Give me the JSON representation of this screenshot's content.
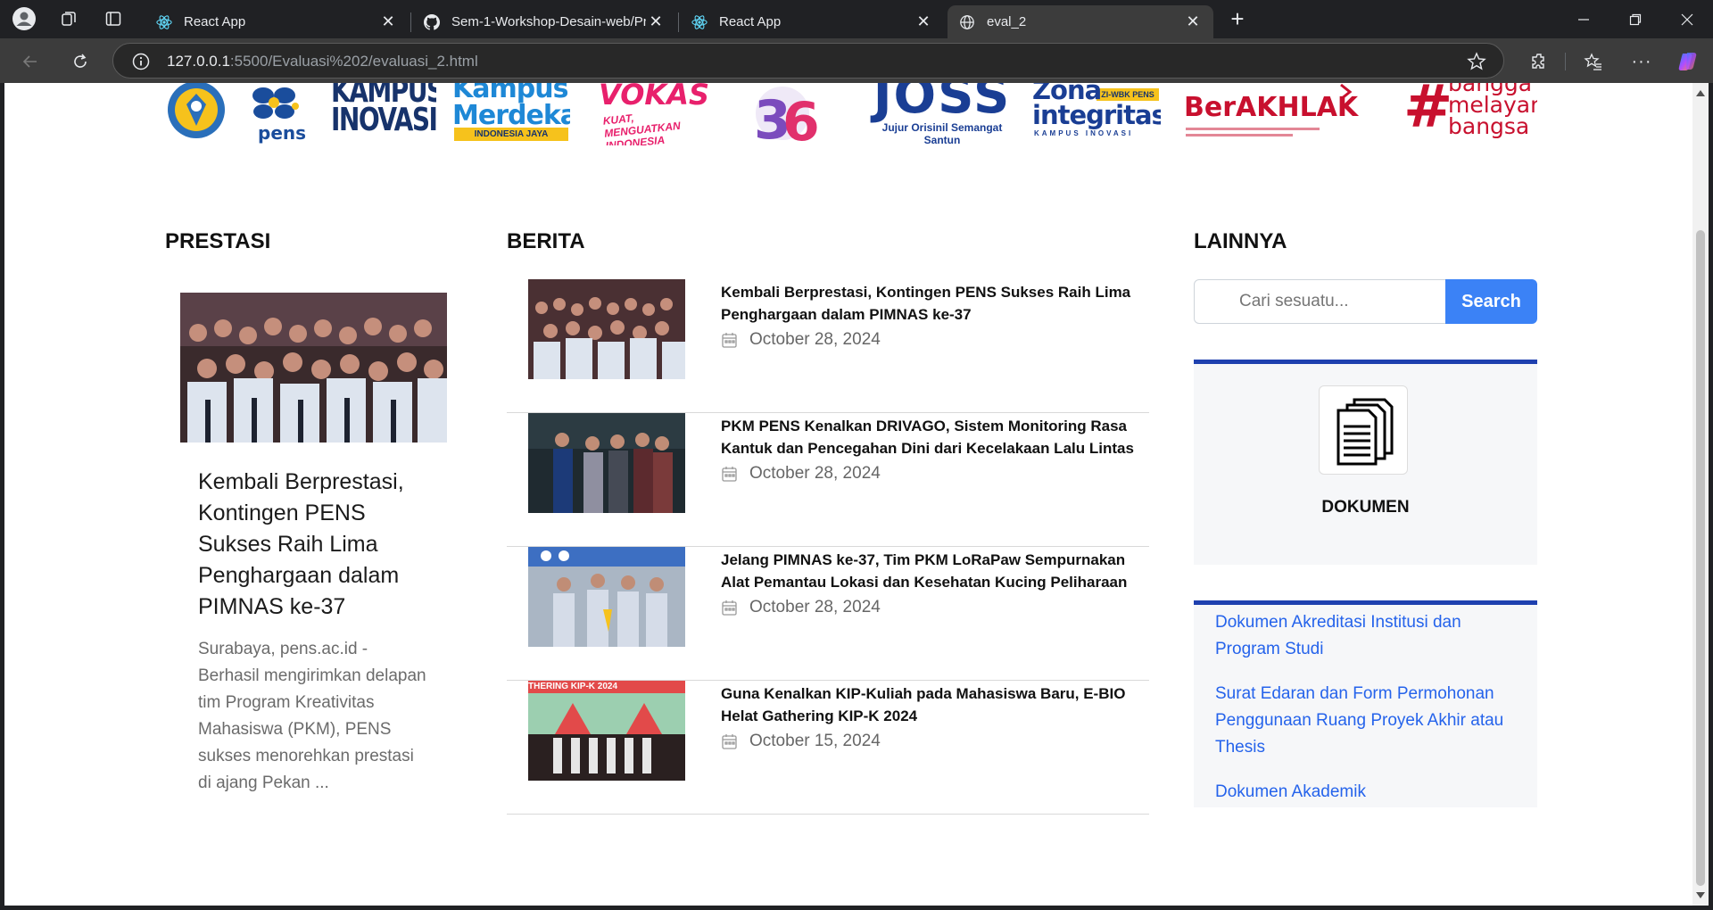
{
  "browser": {
    "tabs": [
      {
        "title": "React App",
        "icon": "react-icon"
      },
      {
        "title": "Sem-1-Workshop-Desain-web/Pr",
        "icon": "github-icon"
      },
      {
        "title": "React App",
        "icon": "react-icon"
      },
      {
        "title": "eval_2",
        "icon": "globe-icon",
        "active": true
      }
    ],
    "url_host": "127.0.0.1",
    "url_rest": ":5500/Evaluasi%202/evaluasi_2.html"
  },
  "logos": [
    {
      "name": "kemdikbud-logo"
    },
    {
      "name": "pens-logo",
      "text": "pens"
    },
    {
      "name": "kampus-inovasi-logo",
      "text": "KAMPUS INOVASI"
    },
    {
      "name": "kampus-merdeka-logo",
      "text": "Kampus Merdeka",
      "sub": "INDONESIA JAYA"
    },
    {
      "name": "vokasi-logo",
      "text": "VOKASI",
      "sub": "KUAT, MENGUATKAN INDONESIA"
    },
    {
      "name": "anniversary-36-logo",
      "text": "36"
    },
    {
      "name": "joss-logo",
      "text": "JOSS",
      "sub": "Jujur Orisinil Semangat Santun"
    },
    {
      "name": "zona-integritas-logo",
      "text": "Zona integritas",
      "badge": "ZI-WBK PENS",
      "sub": "KAMPUS INOVASI"
    },
    {
      "name": "berakhlak-logo",
      "text": "BerAKHLAK"
    },
    {
      "name": "bangga-melayani-bangsa-logo",
      "line1": "bangga",
      "line2": "melayani",
      "line3": "bangsa"
    }
  ],
  "prestasi": {
    "heading": "PRESTASI",
    "title": "Kembali Berprestasi, Kontingen PENS Sukses Raih Lima Penghargaan dalam PIMNAS ke-37",
    "excerpt": "Surabaya, pens.ac.id - Berhasil mengirimkan delapan tim Program Kreativitas Mahasiswa (PKM), PENS sukses menorehkan prestasi di ajang Pekan ..."
  },
  "berita": {
    "heading": "BERITA",
    "items": [
      {
        "title": "Kembali Berprestasi, Kontingen PENS Sukses Raih Lima Penghargaan dalam PIMNAS ke-37",
        "date": "October 28, 2024"
      },
      {
        "title": "PKM PENS Kenalkan DRIVAGO, Sistem Monitoring Rasa Kantuk dan Pencegahan Dini dari Kecelakaan Lalu Lintas",
        "date": "October 28, 2024"
      },
      {
        "title": "Jelang PIMNAS ke-37, Tim PKM LoRaPaw Sempurnakan Alat Pemantau Lokasi dan Kesehatan Kucing Peliharaan",
        "date": "October 28, 2024"
      },
      {
        "title": "Guna Kenalkan KIP-Kuliah pada Mahasiswa Baru, E-BIO Helat Gathering KIP-K 2024",
        "date": "October 15, 2024",
        "banner": "THERING KIP-K 2024"
      }
    ]
  },
  "lainnya": {
    "heading": "LAINNYA",
    "search_placeholder": "Cari sesuatu...",
    "search_button": "Search",
    "doc_label": "DOKUMEN",
    "links": [
      "Dokumen Akreditasi Institusi dan Program Studi",
      "Surat Edaran dan Form Permohonan Penggunaan Ruang Proyek Akhir atau Thesis",
      "Dokumen Akademik"
    ]
  }
}
